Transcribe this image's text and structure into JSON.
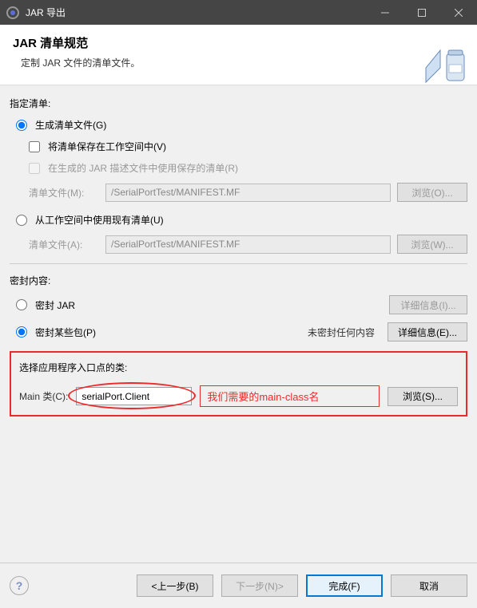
{
  "titlebar": {
    "title": "JAR 导出"
  },
  "header": {
    "title": "JAR 清单规范",
    "subtitle": "定制 JAR 文件的清单文件。"
  },
  "manifest": {
    "section_label": "指定清单:",
    "generate_label": "生成清单文件(G)",
    "save_workspace_label": "将清单保存在工作空间中(V)",
    "use_saved_label": "在生成的 JAR 描述文件中使用保存的清单(R)",
    "file_m_label": "清单文件(M):",
    "file_m_value": "/SerialPortTest/MANIFEST.MF",
    "browse_o": "浏览(O)...",
    "use_existing_label": "从工作空间中使用现有清单(U)",
    "file_a_label": "清单文件(A):",
    "file_a_value": "/SerialPortTest/MANIFEST.MF",
    "browse_w": "浏览(W)..."
  },
  "seal": {
    "section_label": "密封内容:",
    "seal_jar_label": "密封 JAR",
    "details_i": "详细信息(I)...",
    "seal_some_label": "密封某些包(P)",
    "none_sealed": "未密封任何内容",
    "details_e": "详细信息(E)..."
  },
  "entry": {
    "section_label": "选择应用程序入口点的类:",
    "main_label": "Main 类(C):",
    "main_value": "serialPort.Client",
    "annotation": "我们需要的main-class名",
    "browse_s": "浏览(S)..."
  },
  "footer": {
    "help": "?",
    "back": "<上一步(B)",
    "next": "下一步(N)>",
    "finish": "完成(F)",
    "cancel": "取消"
  }
}
